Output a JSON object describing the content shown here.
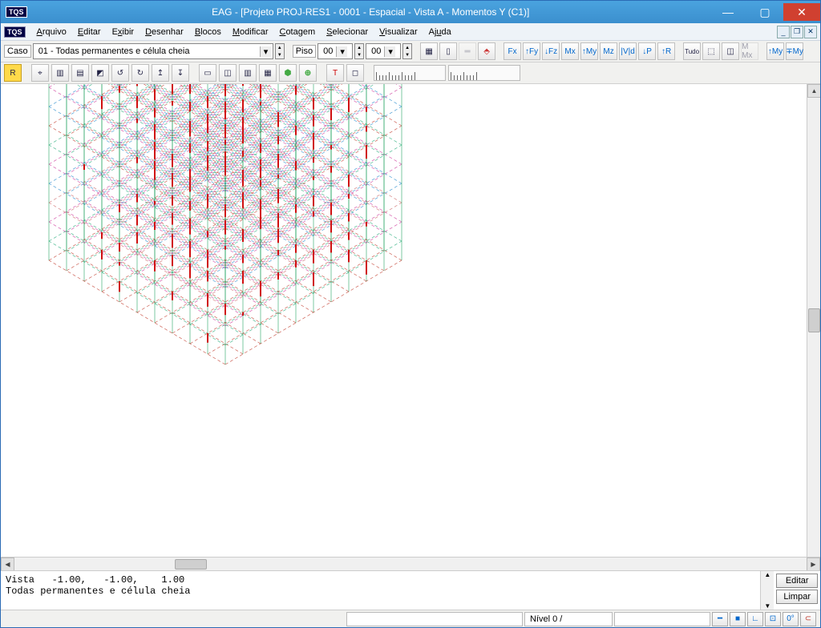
{
  "app": {
    "tqs_chip": "TQS",
    "title": "EAG - [Projeto PROJ-RES1 - 0001 - Espacial - Vista A - Momentos Y (C1)]"
  },
  "menu": {
    "items": [
      "Arquivo",
      "Editar",
      "Exibir",
      "Desenhar",
      "Blocos",
      "Modificar",
      "Cotagem",
      "Selecionar",
      "Visualizar",
      "Ajuda"
    ]
  },
  "toolbar1": {
    "case_label": "Caso",
    "case_value": "01 - Todas permanentes e célula cheia",
    "floor_label": "Piso",
    "floor_value": "00",
    "floor_to": "00",
    "btn_tudo": "Tudo",
    "fx": "Fx",
    "fy": "↑Fy",
    "fz": "↓Fz",
    "mx": "Mx",
    "my": "↑My",
    "mz": "Mz",
    "vd": "|V|d",
    "p": "↓P",
    "r": "↑R",
    "mmx": "M Mx",
    "mmyp": "↑My",
    "mmym": "∓My"
  },
  "toolbar2": {
    "r_btn": "R"
  },
  "log": {
    "line1": "Vista   -1.00,   -1.00,    1.00",
    "line2": "Todas permanentes e célula cheia"
  },
  "buttons": {
    "editar": "Editar",
    "limpar": "Limpar"
  },
  "status": {
    "nivel": "Nível 0 /",
    "deg": "0°"
  },
  "colors": {
    "accent": "#3b8fce",
    "close": "#d04030"
  }
}
